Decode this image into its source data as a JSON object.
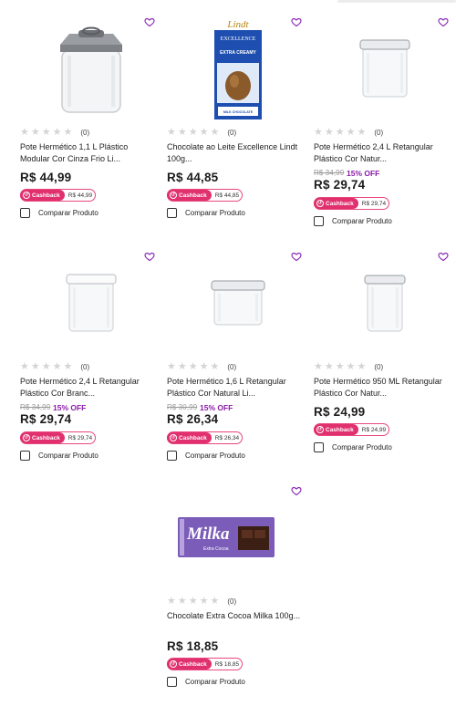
{
  "products": [
    {
      "title": "Pote Hermético 1,1 L Plástico Modular Cor Cinza Frio Li...",
      "image": "gray-lid-canister",
      "rating_count": "(0)",
      "old_price": "",
      "discount": "",
      "price": "R$ 44,99",
      "cashback_label": "Cashback",
      "cashback_value": "R$ 44,99",
      "compare_label": "Comparar Produto"
    },
    {
      "title": "Chocolate ao Leite Excellence Lindt 100g...",
      "image": "lindt-bar",
      "rating_count": "(0)",
      "old_price": "",
      "discount": "",
      "price": "R$ 44,85",
      "cashback_label": "Cashback",
      "cashback_value": "R$ 44,85",
      "compare_label": "Comparar Produto",
      "pack": {
        "brand": "Lindt",
        "line": "EXCELLENCE",
        "flavor": "EXTRA CREAMY",
        "sub": "MILK CHOCOLATE"
      }
    },
    {
      "title": "Pote Hermético 2,4 L Retangular Plástico Cor Natur...",
      "image": "clear-container-tall",
      "rating_count": "(0)",
      "old_price": "R$ 34,99",
      "discount": "15% OFF",
      "price": "R$ 29,74",
      "cashback_label": "Cashback",
      "cashback_value": "R$ 29,74",
      "compare_label": "Comparar Produto"
    },
    {
      "title": "Pote Hermético 2,4 L Retangular Plástico Cor Branc...",
      "image": "clear-container-white-lid",
      "rating_count": "(0)",
      "old_price": "R$ 34,99",
      "discount": "15% OFF",
      "price": "R$ 29,74",
      "cashback_label": "Cashback",
      "cashback_value": "R$ 29,74",
      "compare_label": "Comparar Produto"
    },
    {
      "title": "Pote Hermético 1,6 L Retangular Plástico Cor Natural Li...",
      "image": "clear-container-wide",
      "rating_count": "(0)",
      "old_price": "R$ 30,99",
      "discount": "15% OFF",
      "price": "R$ 26,34",
      "cashback_label": "Cashback",
      "cashback_value": "R$ 26,34",
      "compare_label": "Comparar Produto"
    },
    {
      "title": "Pote Hermético 950 ML Retangular Plástico Cor Natur...",
      "image": "clear-container-slim",
      "rating_count": "(0)",
      "old_price": "",
      "discount": "",
      "price": "R$ 24,99",
      "cashback_label": "Cashback",
      "cashback_value": "R$ 24,99",
      "compare_label": "Comparar Produto"
    },
    {
      "title": "Chocolate Extra Cocoa Milka 100g...",
      "image": "milka-bar",
      "rating_count": "(0)",
      "old_price": "",
      "discount": "",
      "price": "R$ 18,85",
      "cashback_label": "Cashback",
      "cashback_value": "R$ 18,85",
      "compare_label": "Comparar Produto",
      "pack": {
        "brand": "Milka",
        "sub": "Extra Cocoa"
      }
    }
  ],
  "colors": {
    "cashback": "#e0306e",
    "discount": "#8b1aa8",
    "wishlist": "#8b2bb5",
    "milka": "#7b5cb8",
    "lindt": "#1e4fb0"
  }
}
